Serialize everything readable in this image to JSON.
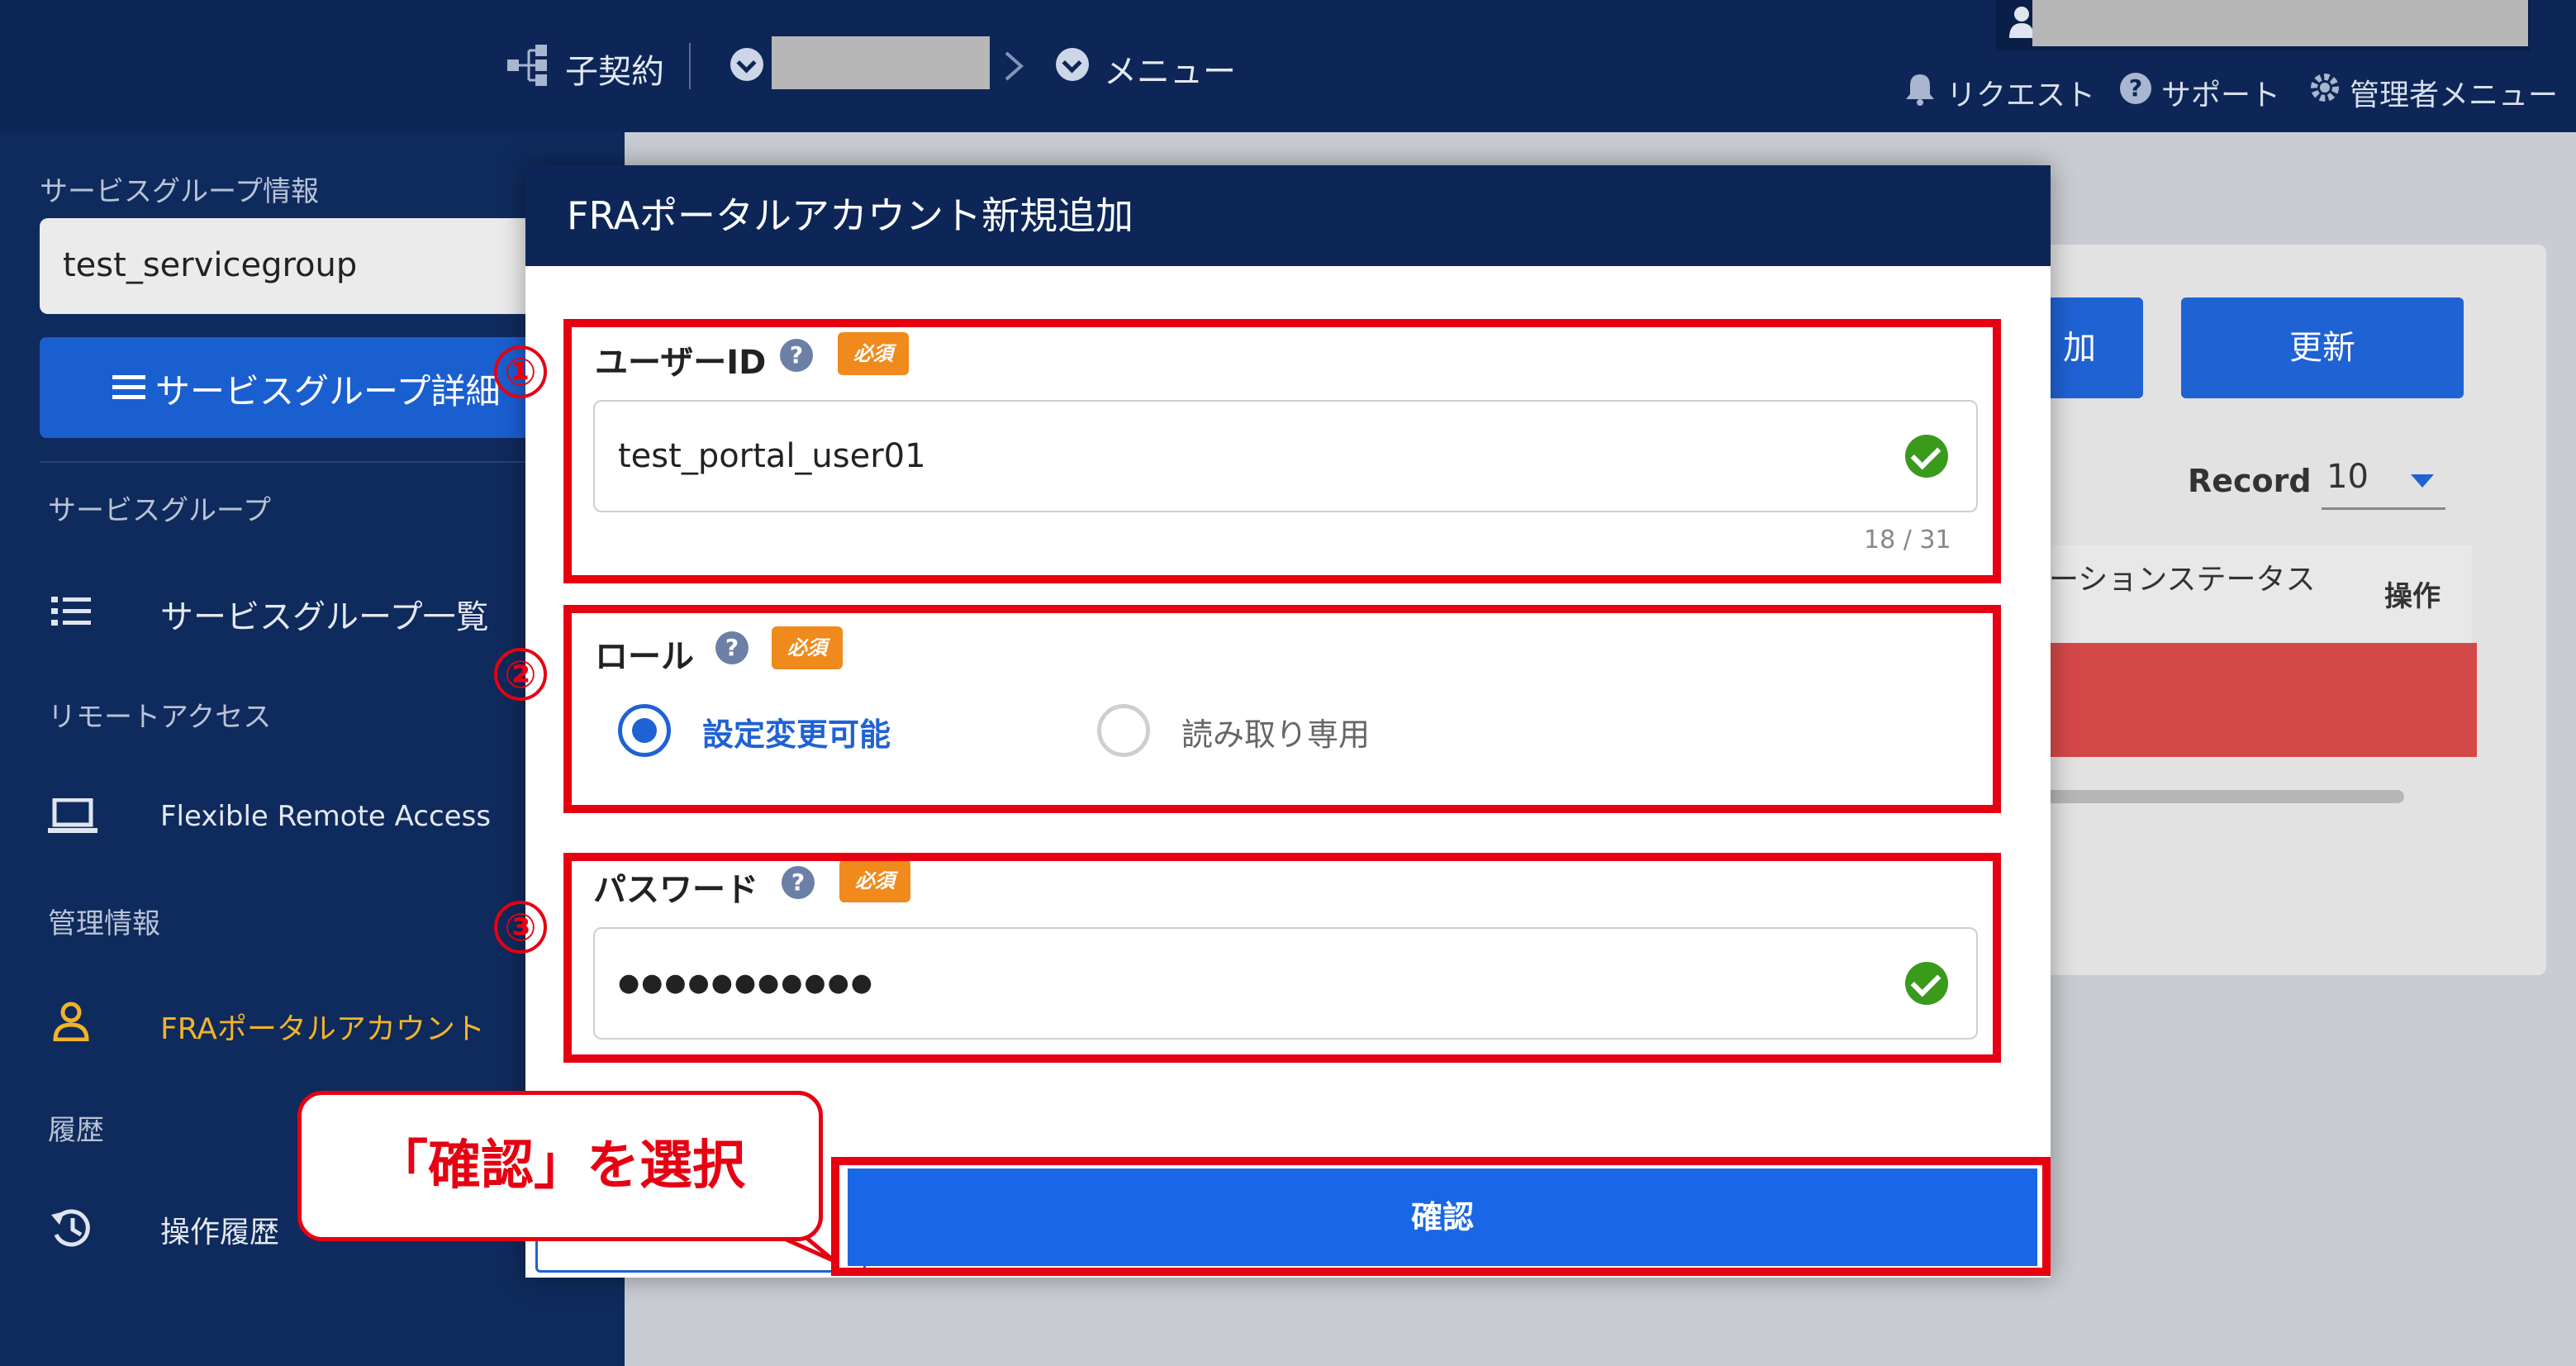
{
  "header": {
    "contract_label": "子契約",
    "menu_label": "メニュー",
    "request_label": "リクエスト",
    "support_label": "サポート",
    "admin_menu_label": "管理者メニュー"
  },
  "sidebar": {
    "group_info_label": "サービスグループ情報",
    "group_value": "test_servicegroup",
    "detail_button": "サービスグループ詳細",
    "sections": {
      "service_group": "サービスグループ",
      "remote_access": "リモートアクセス",
      "management": "管理情報",
      "history": "履歴"
    },
    "items": {
      "group_list": "サービスグループ一覧",
      "fra": "Flexible Remote Access",
      "fra_portal": "FRAポータルアカウント",
      "op_history": "操作履歴"
    },
    "active_color": "#f0b429"
  },
  "main": {
    "add_button_fragment": "加",
    "update_button": "更新",
    "record_label": "Record",
    "record_value": "10",
    "col_status": "ーションステータス",
    "col_action": "操作"
  },
  "modal": {
    "title": "FRAポータルアカウント新規追加",
    "required_badge": "必須",
    "user_id_label": "ユーザーID",
    "user_id_value": "test_portal_user01",
    "user_id_counter": "18 / 31",
    "role_label": "ロール",
    "role_option_1": "設定変更可能",
    "role_option_2": "読み取り専用",
    "password_label": "パスワード",
    "password_value": "●●●●●●●●●●●",
    "confirm_button": "確認"
  },
  "annotations": {
    "num1": "①",
    "num2": "②",
    "num3": "③",
    "callout": "「確認」を選択",
    "highlight_color": "#e60012"
  }
}
